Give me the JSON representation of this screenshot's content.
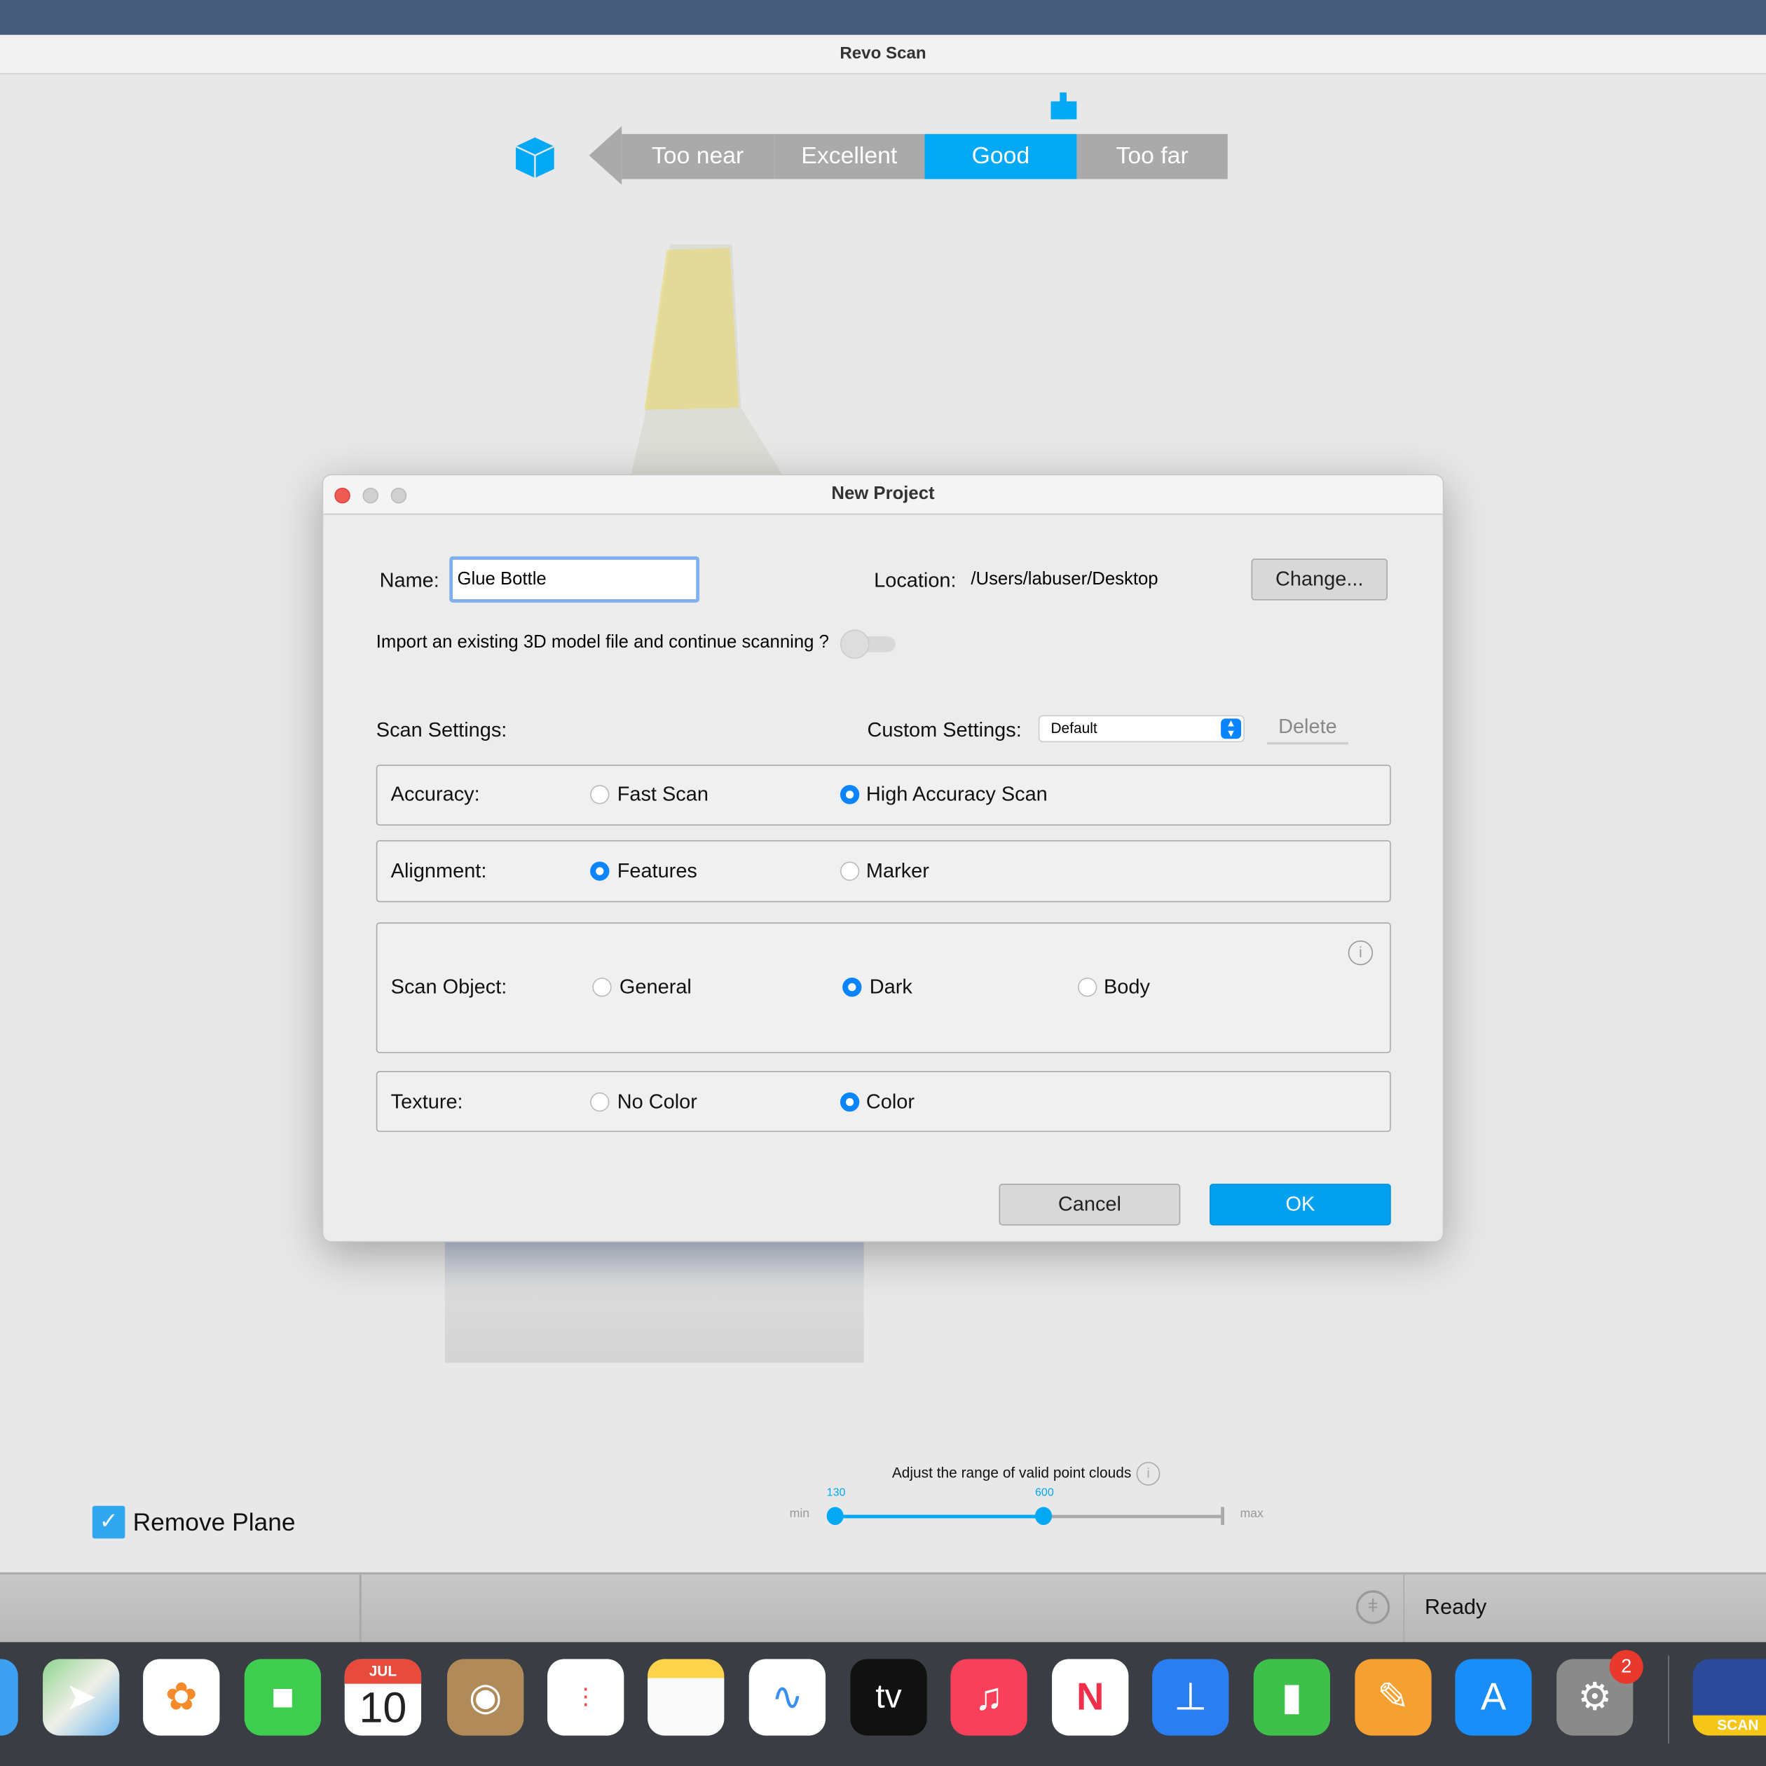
{
  "app": {
    "title": "Revo Scan"
  },
  "distance": {
    "segments": [
      "Too near",
      "Excellent",
      "Good",
      "Too far"
    ],
    "active": "Good",
    "accent": "#03a9f4"
  },
  "dialog": {
    "title": "New Project",
    "name_label": "Name:",
    "name_value": "Glue Bottle",
    "location_label": "Location:",
    "location_value": "/Users/labuser/Desktop",
    "change_button": "Change...",
    "import_label": "Import an existing 3D model file and continue scanning ?",
    "import_enabled": false,
    "scan_settings_label": "Scan Settings:",
    "custom_settings_label": "Custom Settings:",
    "custom_settings_value": "Default",
    "delete_button": "Delete",
    "accuracy": {
      "label": "Accuracy:",
      "options": [
        "Fast Scan",
        "High Accuracy Scan"
      ],
      "selected": "High Accuracy Scan"
    },
    "alignment": {
      "label": "Alignment:",
      "options": [
        "Features",
        "Marker"
      ],
      "selected": "Features"
    },
    "scan_object": {
      "label": "Scan Object:",
      "options": [
        "General",
        "Dark",
        "Body"
      ],
      "selected": "Dark"
    },
    "texture": {
      "label": "Texture:",
      "options": [
        "No Color",
        "Color"
      ],
      "selected": "Color"
    },
    "cancel_button": "Cancel",
    "ok_button": "OK"
  },
  "remove_plane": {
    "label": "Remove Plane",
    "checked": true
  },
  "range": {
    "label": "Adjust the range of valid point clouds",
    "min_label": "min",
    "max_label": "max",
    "low": "130",
    "high": "600"
  },
  "status": {
    "text": "Ready"
  },
  "dock": {
    "calendar_month": "JUL",
    "calendar_day": "10",
    "tv_label": "tv",
    "settings_badge": "2",
    "revo_label": "SCAN"
  }
}
